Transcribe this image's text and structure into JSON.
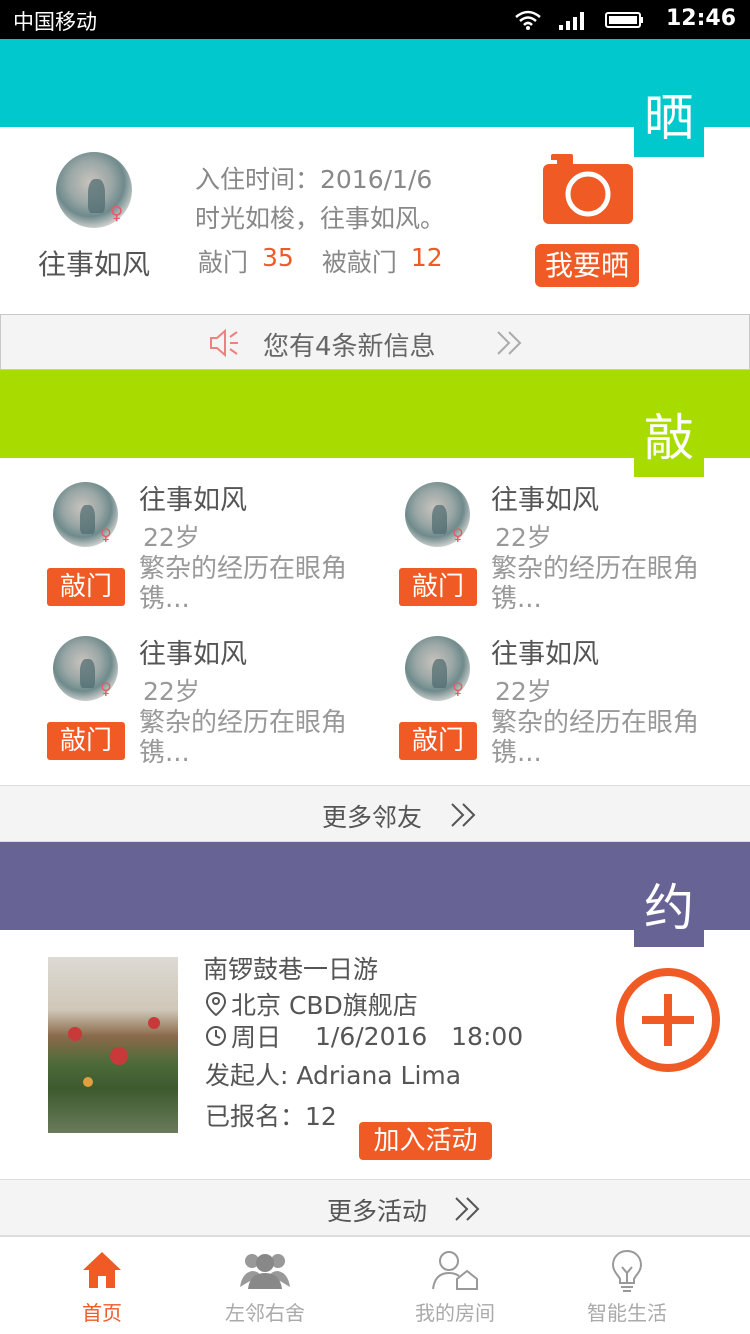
{
  "status_bar": {
    "carrier": "中国移动",
    "time": "12:46"
  },
  "colors": {
    "accent": "#f05a24",
    "cyan": "#00c8cc",
    "green": "#a8dc00",
    "purple": "#676394"
  },
  "sections": {
    "shai": "晒",
    "qiao": "敲",
    "yue": "约"
  },
  "profile": {
    "name": "往事如风",
    "checkin": "入住时间：2016/1/6",
    "motto": "时光如梭，往事如风。",
    "knock_label": "敲门",
    "knock_count": "35",
    "knocked_label": "被敲门",
    "knocked_count": "12",
    "share_button": "我要晒"
  },
  "messages": {
    "text": "您有4条新信息"
  },
  "neighbors": [
    {
      "name": "往事如风",
      "age": "22岁",
      "desc": "繁杂的经历在眼角镌...",
      "button": "敲门"
    },
    {
      "name": "往事如风",
      "age": "22岁",
      "desc": "繁杂的经历在眼角镌...",
      "button": "敲门"
    },
    {
      "name": "往事如风",
      "age": "22岁",
      "desc": "繁杂的经历在眼角镌...",
      "button": "敲门"
    },
    {
      "name": "往事如风",
      "age": "22岁",
      "desc": "繁杂的经历在眼角镌...",
      "button": "敲门"
    }
  ],
  "more_neighbors": "更多邻友",
  "activity": {
    "title": "南锣鼓巷一日游",
    "location": "北京 CBD旗舰店",
    "day": "周日",
    "datetime": "1/6/2016   18:00",
    "organizer": "发起人: Adriana Lima",
    "signed_up": "已报名：12",
    "join_button": "加入活动"
  },
  "more_activities": "更多活动",
  "tabs": [
    {
      "label": "首页",
      "icon": "home-icon",
      "active": true
    },
    {
      "label": "左邻右舍",
      "icon": "people-icon",
      "active": false
    },
    {
      "label": "我的房间",
      "icon": "user-house-icon",
      "active": false
    },
    {
      "label": "智能生活",
      "icon": "bulb-icon",
      "active": false
    }
  ]
}
